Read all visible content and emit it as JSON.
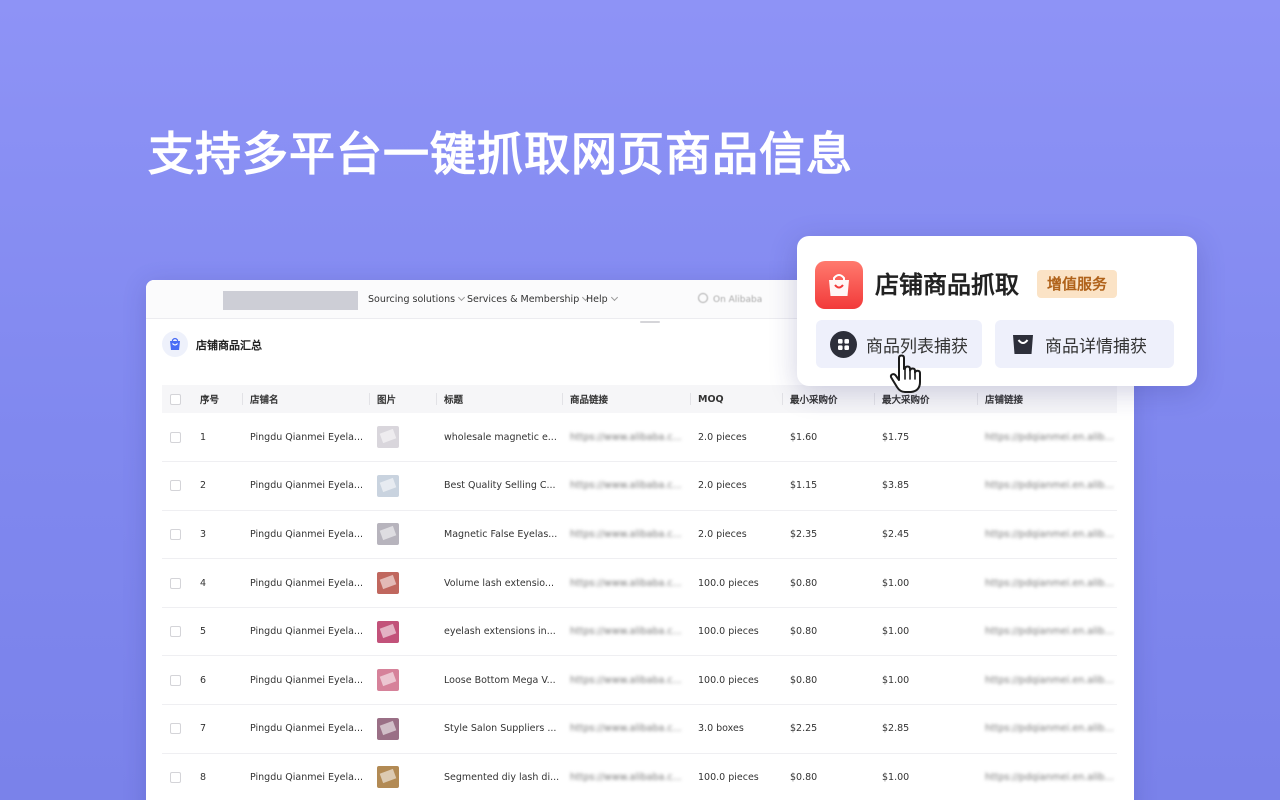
{
  "headline": "支持多平台一键抓取网页商品信息",
  "topnav": {
    "items": [
      {
        "label": "Sourcing solutions"
      },
      {
        "label": "Services & Membership"
      },
      {
        "label": "Help"
      }
    ],
    "search_placeholder": "On Alibaba"
  },
  "panel": {
    "title": "店铺商品汇总"
  },
  "table": {
    "columns": [
      "序号",
      "店铺名",
      "图片",
      "标题",
      "商品链接",
      "MOQ",
      "最小采购价",
      "最大采购价",
      "店铺链接"
    ],
    "rows": [
      {
        "no": "1",
        "shop": "Pingdu Qianmei Eyela...",
        "title": "wholesale magnetic e...",
        "link": "https://www.alibaba.c...",
        "moq": "2.0 pieces",
        "min": "$1.60",
        "max": "$1.75",
        "shop_link": "https://pdqianmei.en.alibab...",
        "thumb": "#d9d6dc"
      },
      {
        "no": "2",
        "shop": "Pingdu Qianmei Eyela...",
        "title": "Best Quality Selling C...",
        "link": "https://www.alibaba.c...",
        "moq": "2.0 pieces",
        "min": "$1.15",
        "max": "$3.85",
        "shop_link": "https://pdqianmei.en.alibab...",
        "thumb": "#c9d3df"
      },
      {
        "no": "3",
        "shop": "Pingdu Qianmei Eyela...",
        "title": "Magnetic False Eyelas...",
        "link": "https://www.alibaba.c...",
        "moq": "2.0 pieces",
        "min": "$2.35",
        "max": "$2.45",
        "shop_link": "https://pdqianmei.en.alibab...",
        "thumb": "#b7b4bd"
      },
      {
        "no": "4",
        "shop": "Pingdu Qianmei Eyela...",
        "title": "Volume lash extensio...",
        "link": "https://www.alibaba.c...",
        "moq": "100.0 pieces",
        "min": "$0.80",
        "max": "$1.00",
        "shop_link": "https://pdqianmei.en.alibab...",
        "thumb": "#c0675e"
      },
      {
        "no": "5",
        "shop": "Pingdu Qianmei Eyela...",
        "title": "eyelash extensions in...",
        "link": "https://www.alibaba.c...",
        "moq": "100.0 pieces",
        "min": "$0.80",
        "max": "$1.00",
        "shop_link": "https://pdqianmei.en.alibab...",
        "thumb": "#c2527a"
      },
      {
        "no": "6",
        "shop": "Pingdu Qianmei Eyela...",
        "title": "Loose Bottom Mega V...",
        "link": "https://www.alibaba.c...",
        "moq": "100.0 pieces",
        "min": "$0.80",
        "max": "$1.00",
        "shop_link": "https://pdqianmei.en.alibab...",
        "thumb": "#d6829a"
      },
      {
        "no": "7",
        "shop": "Pingdu Qianmei Eyela...",
        "title": "Style Salon Suppliers ...",
        "link": "https://www.alibaba.c...",
        "moq": "3.0 boxes",
        "min": "$2.25",
        "max": "$2.85",
        "shop_link": "https://pdqianmei.en.alibab...",
        "thumb": "#9a6f86"
      },
      {
        "no": "8",
        "shop": "Pingdu Qianmei Eyela...",
        "title": "Segmented diy lash di...",
        "link": "https://www.alibaba.c...",
        "moq": "100.0 pieces",
        "min": "$0.80",
        "max": "$1.00",
        "shop_link": "https://pdqianmei.en.alibab...",
        "thumb": "#b28a54"
      }
    ]
  },
  "card": {
    "title": "店铺商品抓取",
    "badge": "增值服务",
    "btn_list": "商品列表捕获",
    "btn_detail": "商品详情捕获"
  },
  "colors": {
    "accent": "#7b82ec",
    "app_icon": "#f23a3a",
    "badge_bg": "#fbe3c6",
    "badge_text": "#b0621a"
  }
}
